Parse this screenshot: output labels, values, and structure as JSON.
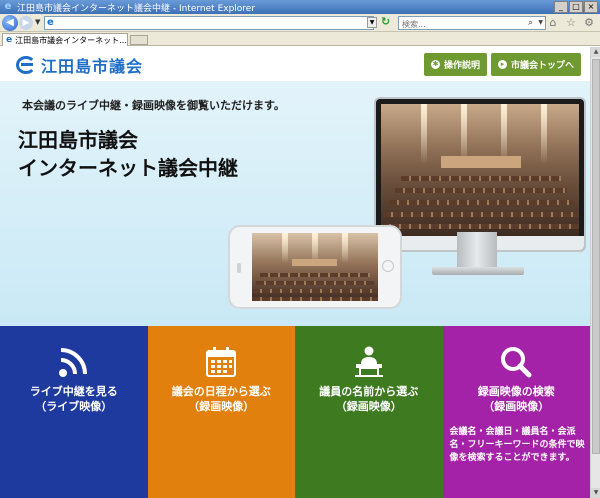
{
  "window": {
    "title": "江田島市議会インターネット議会中継 - Internet Explorer",
    "buttons": {
      "minimize": "_",
      "maximize": "□",
      "close": "×"
    }
  },
  "browser": {
    "address_value": "",
    "search_placeholder": "検索...",
    "tab_label": "江田島市議会インターネット...",
    "tab_close": "×",
    "toolbar_icons": [
      "home-icon",
      "favorites-star-icon",
      "settings-gear-icon"
    ]
  },
  "header": {
    "logo_text": "江田島市議会",
    "buttons": {
      "howto": "操作説明",
      "council_top": "市議会トップへ"
    }
  },
  "hero": {
    "tagline": "本会議のライブ中継・録画映像を御覧いただけます。",
    "title_line1": "江田島市議会",
    "title_line2": "インターネット議会中継"
  },
  "tiles": [
    {
      "label1": "ライブ中継を見る",
      "label2": "（ライブ映像）",
      "icon": "live-broadcast-icon",
      "color": "#1e3a9e"
    },
    {
      "label1": "議会の日程から選ぶ",
      "label2": "（録画映像）",
      "icon": "calendar-icon",
      "color": "#e2800e"
    },
    {
      "label1": "議員の名前から選ぶ",
      "label2": "（録画映像）",
      "icon": "speaker-podium-icon",
      "color": "#3e7a1f"
    },
    {
      "label1": "録画映像の検索",
      "label2": "（録画映像）",
      "icon": "search-magnifier-icon",
      "color": "#a422a8",
      "description": "会議名・会議日・議員名・会派名・フリーキーワードの条件で映像を検索することができます。"
    }
  ]
}
